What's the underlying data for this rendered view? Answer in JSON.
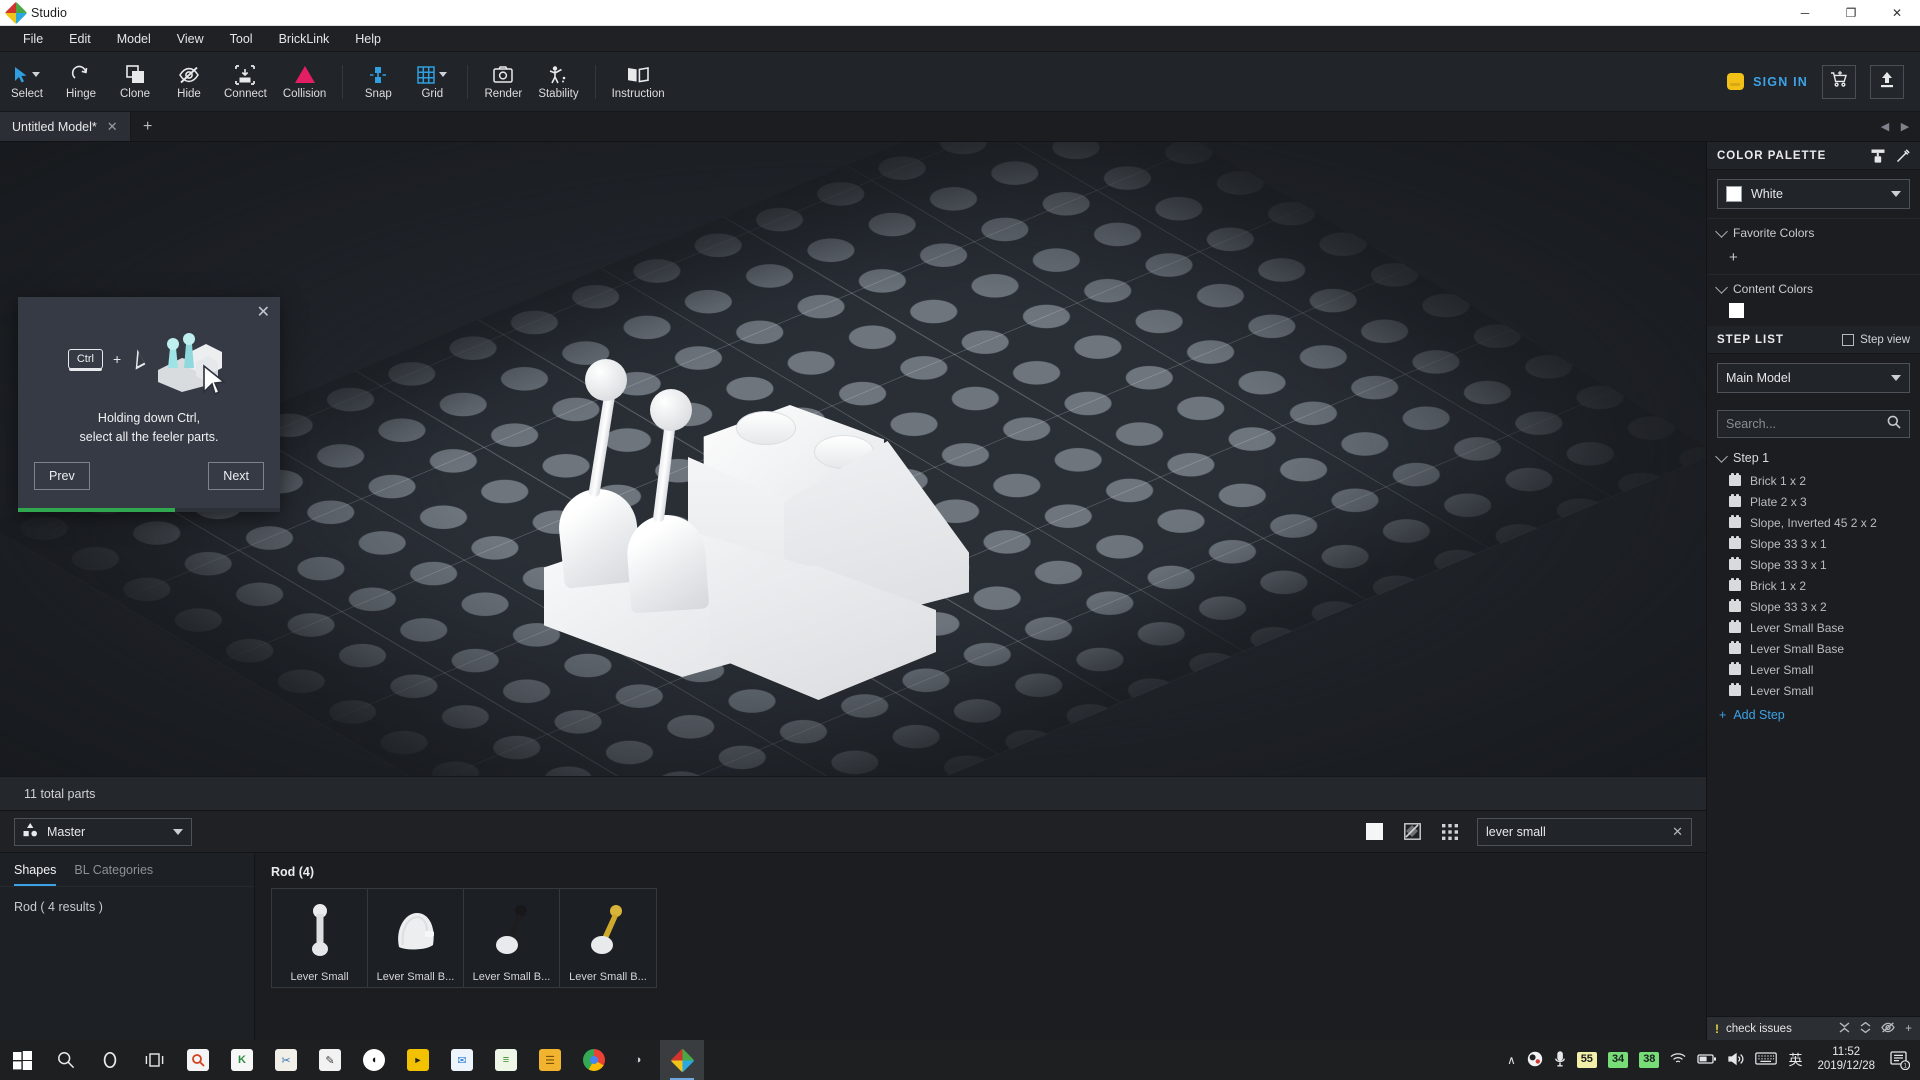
{
  "window": {
    "title": "Studio",
    "minimize": "─",
    "maximize": "❐",
    "close": "✕"
  },
  "menu": [
    "File",
    "Edit",
    "Model",
    "View",
    "Tool",
    "BrickLink",
    "Help"
  ],
  "toolbar": {
    "tools": [
      {
        "label": "Select",
        "icon": "cursor-icon",
        "dropdown": true
      },
      {
        "label": "Hinge",
        "icon": "hinge-icon",
        "dropdown": false
      },
      {
        "label": "Clone",
        "icon": "clone-icon",
        "dropdown": false
      },
      {
        "label": "Hide",
        "icon": "hide-eye-icon",
        "dropdown": false
      },
      {
        "label": "Connect",
        "icon": "connect-icon",
        "dropdown": false
      },
      {
        "label": "Collision",
        "icon": "collision-triangle-icon",
        "dropdown": false
      },
      {
        "label": "Snap",
        "icon": "snap-icon",
        "dropdown": false
      },
      {
        "label": "Grid",
        "icon": "grid-icon",
        "dropdown": true
      },
      {
        "label": "Render",
        "icon": "camera-icon",
        "dropdown": false
      },
      {
        "label": "Stability",
        "icon": "stability-figure-icon",
        "dropdown": false
      },
      {
        "label": "Instruction",
        "icon": "book-icon",
        "dropdown": false
      }
    ],
    "signin_label": "SIGN IN",
    "cart_icon": "cart-icon",
    "upload_icon": "upload-icon"
  },
  "tabs": {
    "documents": [
      {
        "label": "Untitled Model*",
        "close": "✕"
      }
    ],
    "new_tab": "+",
    "nav_prev": "◀",
    "nav_next": "▶"
  },
  "viewport": {
    "status": "11 total parts"
  },
  "tutorial": {
    "close": "✕",
    "key_label": "Ctrl",
    "plus": "+",
    "text_line1": "Holding down Ctrl,",
    "text_line2": "select all the feeler parts.",
    "prev_label": "Prev",
    "next_label": "Next",
    "progress_percent": 60
  },
  "parts_browser": {
    "palette_selector": "Master",
    "view_icons": [
      "solid-swatch-icon",
      "pattern-swatch-icon",
      "grid-view-icon"
    ],
    "search_value": "lever small",
    "search_clear": "✕",
    "tabs": [
      {
        "label": "Shapes",
        "active": true
      },
      {
        "label": "BL Categories",
        "active": false
      }
    ],
    "result_summary": "Rod ( 4 results )",
    "group_title": "Rod (4)",
    "items": [
      {
        "name": "Lever Small",
        "color": "#e8eaec"
      },
      {
        "name": "Lever Small B...",
        "color": "#e3e5e7"
      },
      {
        "name": "Lever Small B...",
        "color": "#1b1b1b"
      },
      {
        "name": "Lever Small B...",
        "color": "#d2ae2b"
      }
    ]
  },
  "color_palette": {
    "title": "COLOR PALETTE",
    "header_icons": [
      "paint-roller-icon",
      "eyedropper-icon"
    ],
    "selected_color": "White",
    "selected_hex": "#ffffff",
    "favorite_colors_label": "Favorite Colors",
    "favorite_add": "+",
    "content_colors_label": "Content Colors",
    "content_swatch_hex": "#ffffff"
  },
  "step_list": {
    "title": "STEP LIST",
    "step_view_label": "Step view",
    "step_view_checked": false,
    "model_selector": "Main Model",
    "search_placeholder": "Search...",
    "search_value": "",
    "search_icon": "search-icon",
    "step_label": "Step 1",
    "parts": [
      "Brick 1 x 2",
      "Plate 2 x 3",
      "Slope, Inverted 45 2 x 2",
      "Slope 33 3 x 1",
      "Slope 33 3 x 1",
      "Brick 1 x 2",
      "Slope 33 3 x 2",
      "Lever Small Base",
      "Lever Small Base",
      "Lever Small",
      "Lever Small"
    ],
    "add_step_label": "Add Step",
    "add_step_icon": "plus-icon"
  },
  "issues_bar": {
    "label": "check issues",
    "warning_icon": "warning-icon",
    "icons": [
      "collapse-icon",
      "expand-vertical-icon",
      "hide-eye-icon",
      "plus-icon"
    ]
  },
  "taskbar": {
    "items": [
      {
        "name": "start-button",
        "glyph": "⊞",
        "bg": "transparent",
        "fg": "#ffffff"
      },
      {
        "name": "search-icon",
        "glyph": "⚲",
        "bg": "transparent",
        "fg": "#e8eaec"
      },
      {
        "name": "cortana-icon",
        "glyph": "◯",
        "bg": "transparent",
        "fg": "#e8eaec"
      },
      {
        "name": "task-view-icon",
        "glyph": "⌸",
        "bg": "transparent",
        "fg": "#e8eaec"
      },
      {
        "name": "pdf-reader-app",
        "glyph": "⌕",
        "bg": "#f5f5f5",
        "fg": "#d4411e"
      },
      {
        "name": "kingsoft-app",
        "glyph": "K",
        "bg": "#f7f7f7",
        "fg": "#2c8f3f"
      },
      {
        "name": "snip-tool-app",
        "glyph": "✂",
        "bg": "#f0efe8",
        "fg": "#2f6fb0"
      },
      {
        "name": "notepad-app",
        "glyph": "✎",
        "bg": "#f2f2f2",
        "fg": "#444444"
      },
      {
        "name": "obs-app",
        "glyph": "◐",
        "bg": "#ffffff",
        "fg": "#111111"
      },
      {
        "name": "media-player-app",
        "glyph": "▶",
        "bg": "#f2c200",
        "fg": "#222222"
      },
      {
        "name": "foxmail-app",
        "glyph": "✉",
        "bg": "#eef4fb",
        "fg": "#2f7fd0"
      },
      {
        "name": "editor-app",
        "glyph": "≡",
        "bg": "#eef7e6",
        "fg": "#3a8b2e"
      },
      {
        "name": "file-explorer-app",
        "glyph": "☰",
        "bg": "#f2b32e",
        "fg": "#7a5208"
      },
      {
        "name": "chrome-app",
        "glyph": "●",
        "bg": "#f5f5f5",
        "fg": "#2aa84a"
      },
      {
        "name": "obs-studio-app",
        "glyph": "◑",
        "bg": "transparent",
        "fg": "#cfd2d6"
      },
      {
        "name": "studio-app",
        "glyph": "◆",
        "bg": "transparent",
        "fg": "#4aa845"
      }
    ],
    "tray": {
      "chevron": "∧",
      "obs_icon": "obs-tray-icon",
      "mic_icon": "microphone-icon",
      "badges": [
        {
          "value": "55",
          "bg": "#f2f0a8"
        },
        {
          "value": "34",
          "bg": "#77dd77"
        },
        {
          "value": "38",
          "bg": "#77dd77"
        }
      ],
      "wifi_icon": "wifi-icon",
      "battery_icon": "battery-icon",
      "volume_icon": "volume-icon",
      "keyboard_icon": "keyboard-icon",
      "ime_label": "英",
      "time": "11:52",
      "date": "2019/12/28",
      "notification_count": "1",
      "notification_icon": "notification-icon"
    }
  }
}
